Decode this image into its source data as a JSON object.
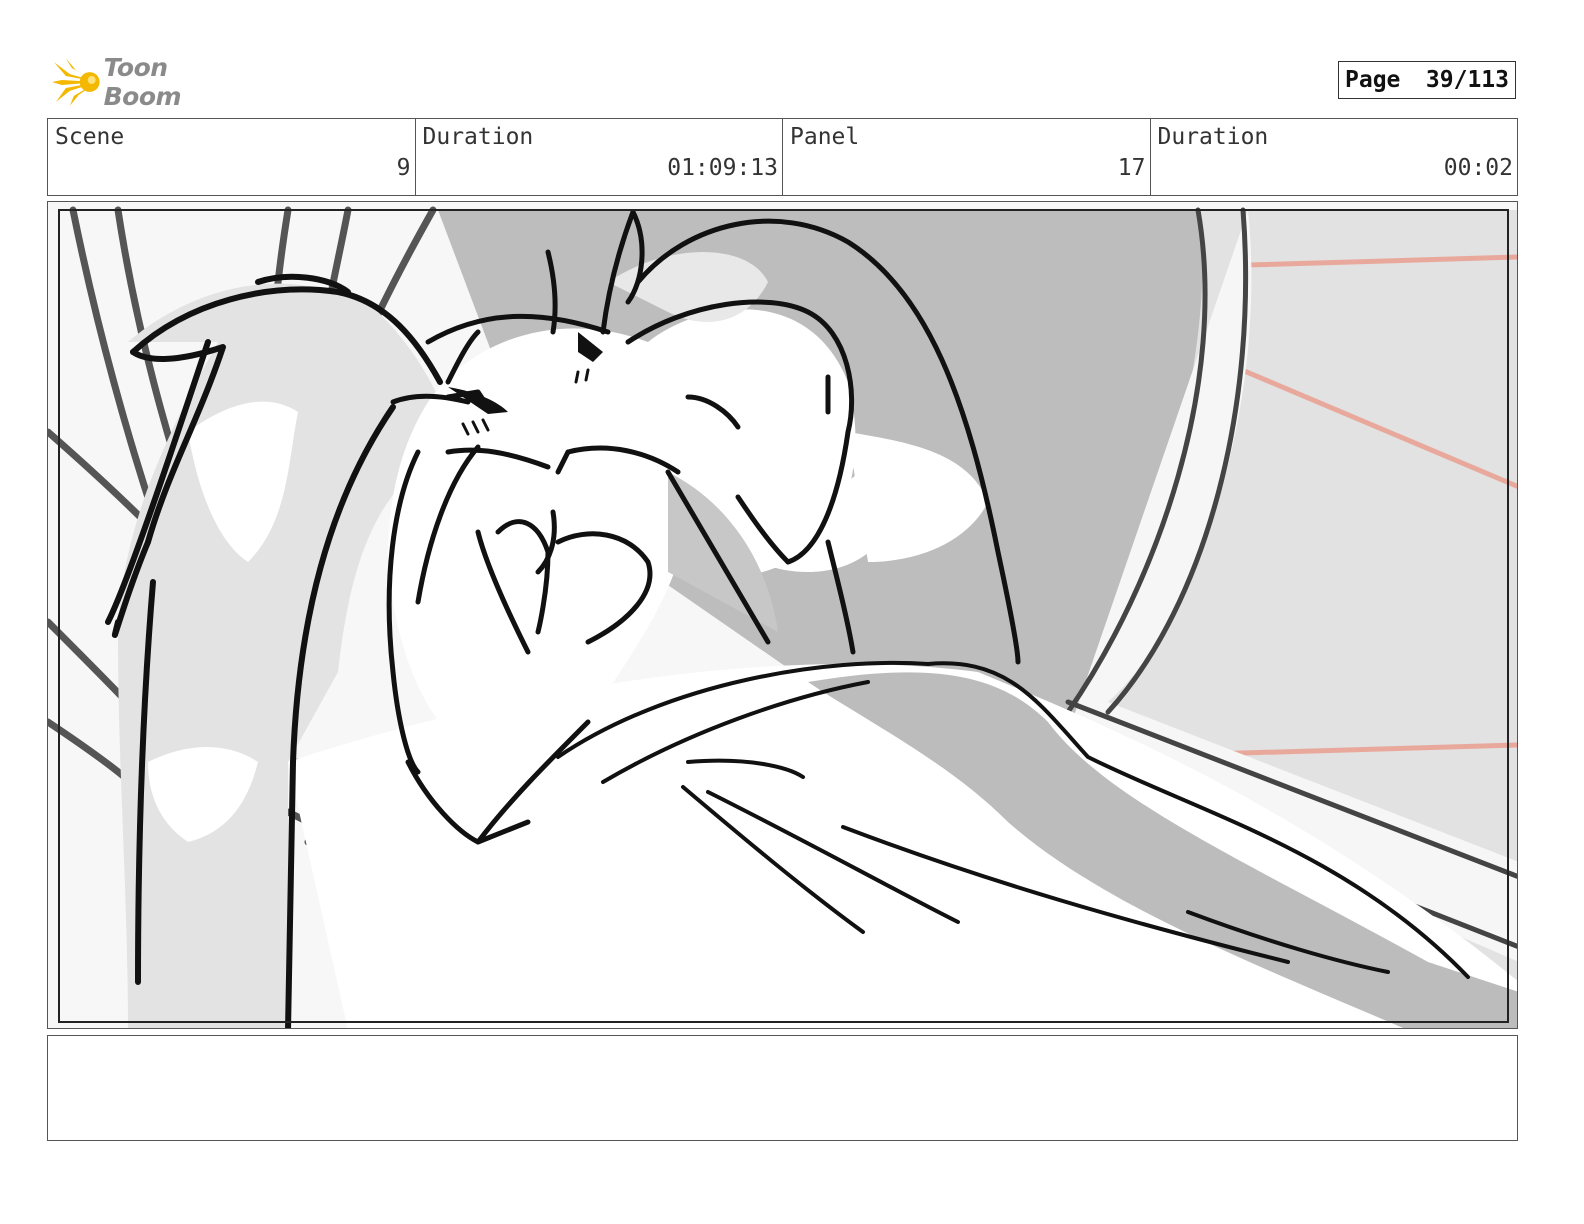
{
  "header": {
    "logo_text": "Toon Boom",
    "page_label": "Page",
    "page_value": "39/113"
  },
  "info": {
    "scene_label": "Scene",
    "scene_value": "9",
    "scene_duration_label": "Duration",
    "scene_duration_value": "01:09:13",
    "panel_label": "Panel",
    "panel_value": "17",
    "panel_duration_label": "Duration",
    "panel_duration_value": "00:02"
  },
  "notes": {
    "text": ""
  },
  "colors": {
    "logo_star": "#f5b800",
    "logo_text": "#8a8a8a",
    "sketch_ink": "#111111",
    "sketch_gray": "#bdbdbd",
    "sketch_light": "#e4e4e4",
    "guide_red": "#e8a99c"
  }
}
